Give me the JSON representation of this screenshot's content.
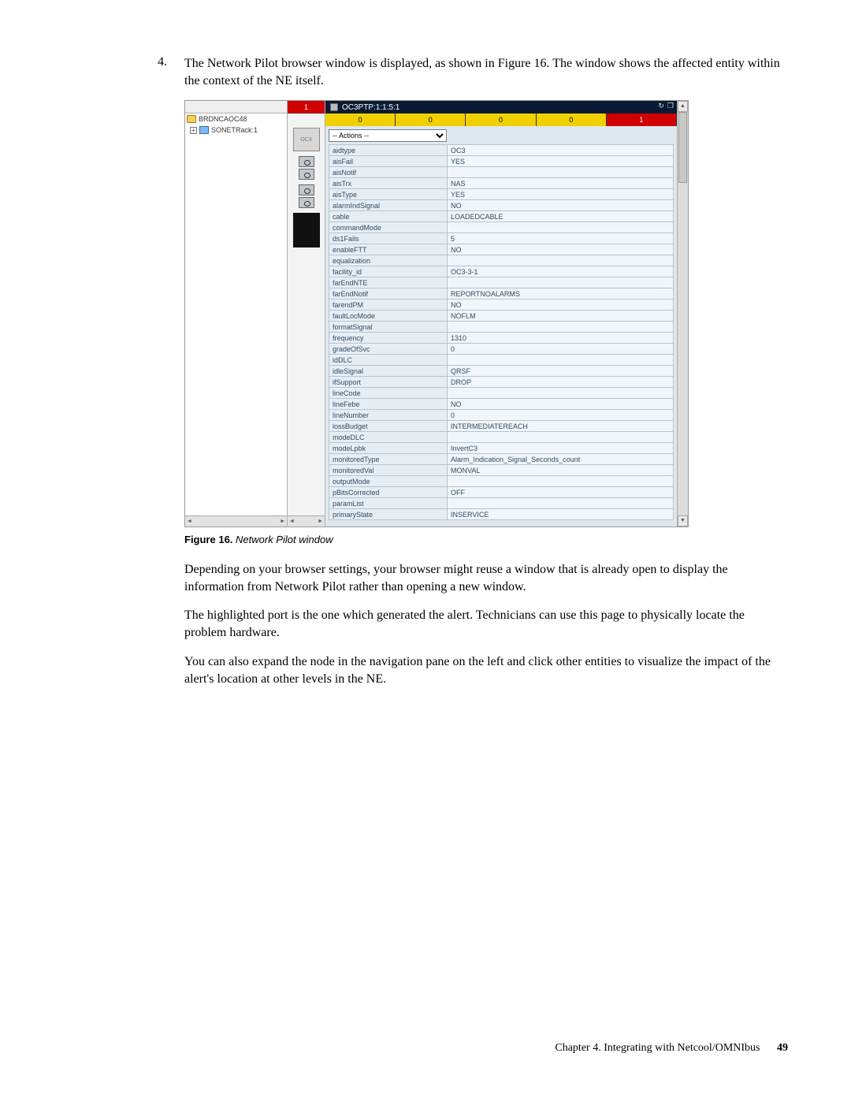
{
  "step": {
    "number": "4.",
    "text": "The Network Pilot browser window is displayed, as shown in Figure 16. The window shows the affected entity within the context of the NE itself."
  },
  "figure": {
    "caption_label": "Figure 16.",
    "caption_title": "Network Pilot window",
    "nav": {
      "root": "BRDNCAOC48",
      "child": "SONETRack:1"
    },
    "title": "OC3PTP:1:1:5:1",
    "slots": [
      "0",
      "0",
      "0",
      "0",
      "1"
    ],
    "actions_placeholder": "-- Actions --",
    "mid_label": "OC3",
    "properties": [
      {
        "k": "aidtype",
        "v": "OC3"
      },
      {
        "k": "aisFail",
        "v": "YES"
      },
      {
        "k": "aisNotif",
        "v": ""
      },
      {
        "k": "aisTrx",
        "v": "NAS"
      },
      {
        "k": "aisType",
        "v": "YES"
      },
      {
        "k": "alarmIndSignal",
        "v": "NO"
      },
      {
        "k": "cable",
        "v": "LOADEDCABLE"
      },
      {
        "k": "commandMode",
        "v": ""
      },
      {
        "k": "ds1Fails",
        "v": "5"
      },
      {
        "k": "enableFTT",
        "v": "NO"
      },
      {
        "k": "equalization",
        "v": ""
      },
      {
        "k": "facility_id",
        "v": "OC3-3-1"
      },
      {
        "k": "farEndNTE",
        "v": ""
      },
      {
        "k": "farEndNotif",
        "v": "REPORTNOALARMS"
      },
      {
        "k": "farendPM",
        "v": "NO"
      },
      {
        "k": "faultLocMode",
        "v": "NOFLM"
      },
      {
        "k": "formatSignal",
        "v": ""
      },
      {
        "k": "frequency",
        "v": "1310"
      },
      {
        "k": "gradeOfSvc",
        "v": "0"
      },
      {
        "k": "idDLC",
        "v": ""
      },
      {
        "k": "idleSignal",
        "v": "QRSF"
      },
      {
        "k": "ifSupport",
        "v": "DROP"
      },
      {
        "k": "lineCode",
        "v": ""
      },
      {
        "k": "lineFebe",
        "v": "NO"
      },
      {
        "k": "lineNumber",
        "v": "0"
      },
      {
        "k": "lossBudget",
        "v": "INTERMEDIATEREACH"
      },
      {
        "k": "modeDLC",
        "v": ""
      },
      {
        "k": "modeLpbk",
        "v": "InvertC3"
      },
      {
        "k": "monitoredType",
        "v": "Alarm_Indication_Signal_Seconds_count"
      },
      {
        "k": "monitoredVal",
        "v": "MONVAL"
      },
      {
        "k": "outputMode",
        "v": ""
      },
      {
        "k": "pBitsCorrected",
        "v": "OFF"
      },
      {
        "k": "paramList",
        "v": ""
      },
      {
        "k": "primaryState",
        "v": "INSERVICE"
      }
    ]
  },
  "paragraphs": {
    "p1": "Depending on your browser settings, your browser might reuse a window that is already open to display the information from Network Pilot rather than opening a new window.",
    "p2": "The highlighted port is the one which generated the alert. Technicians can use this page to physically locate the problem hardware.",
    "p3": "You can also expand the node in the navigation pane on the left and click other entities to visualize the impact of the alert's location at other levels in the NE."
  },
  "footer": {
    "chapter": "Chapter 4. Integrating with Netcool/OMNIbus",
    "page": "49"
  }
}
